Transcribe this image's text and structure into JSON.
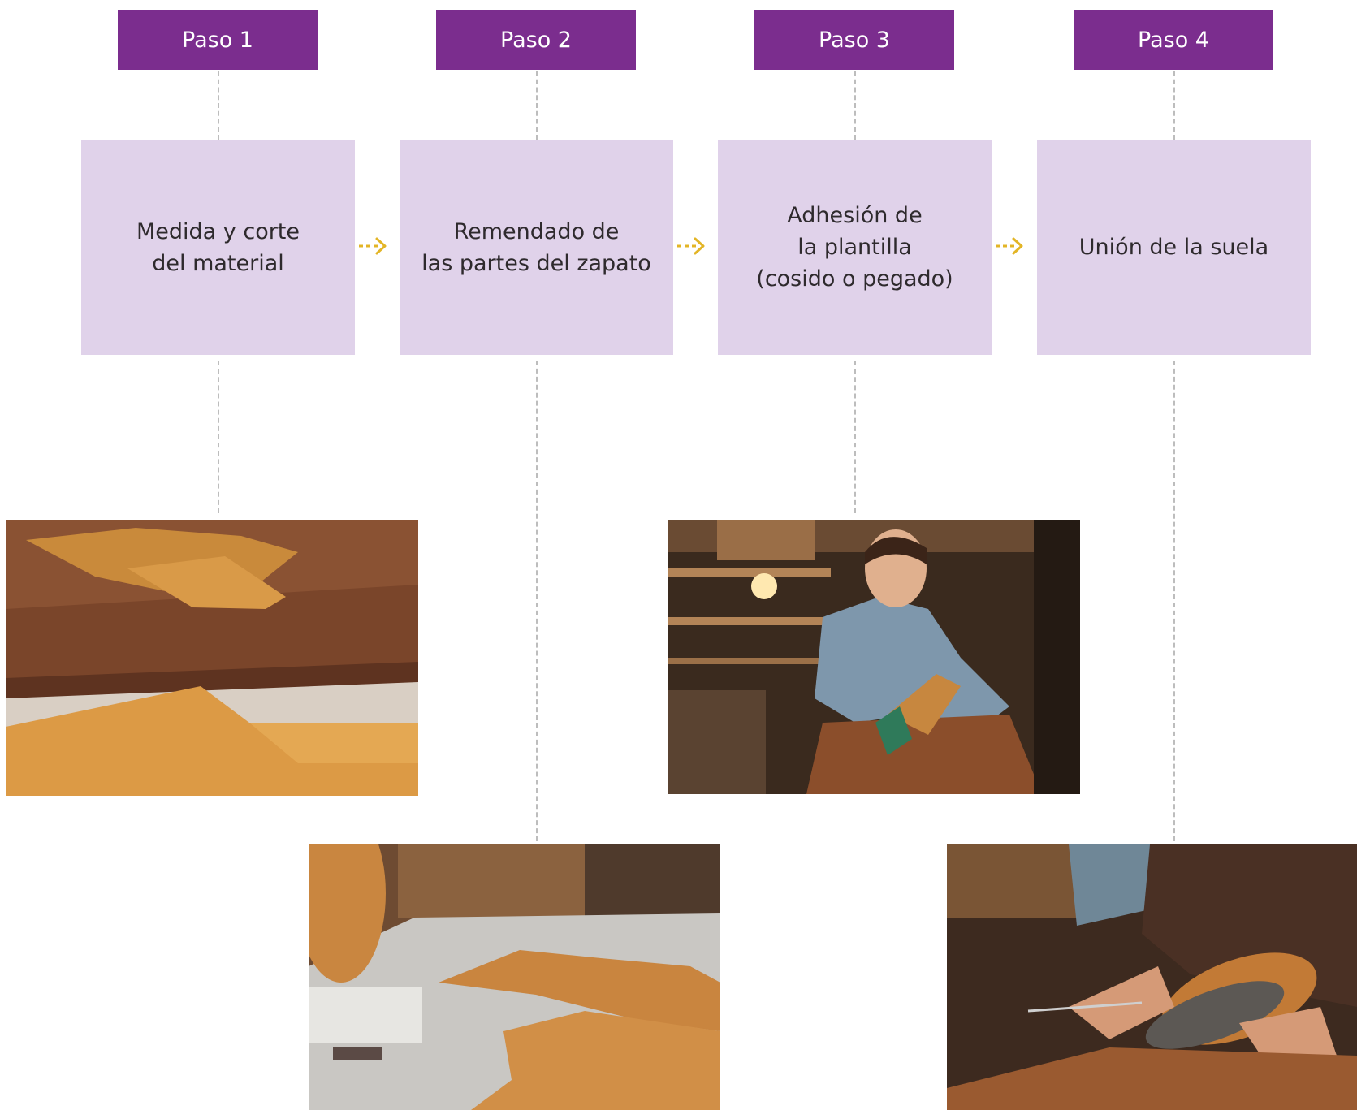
{
  "theme": {
    "header_color": "#7b2d8e",
    "box_color": "#e0d2ea",
    "arrow_color": "#e3b526",
    "connector_color": "#bdbdbd"
  },
  "steps": [
    {
      "header": "Paso 1",
      "lines": [
        "Medida y corte",
        "del material"
      ],
      "photo": "leather pieces cut on a cork board"
    },
    {
      "header": "Paso 2",
      "lines": [
        "Remendado de",
        "las partes del zapato"
      ],
      "photo": "leather shoe parts on a sewing table"
    },
    {
      "header": "Paso 3",
      "lines": [
        "Adhesión de",
        "la plantilla",
        "(cosido o pegado)"
      ],
      "photo": "shoemaker stitching a shoe in a workshop"
    },
    {
      "header": "Paso 4",
      "lines": [
        "Unión de la suela"
      ],
      "photo": "hands attaching a sole to a leather shoe"
    }
  ]
}
